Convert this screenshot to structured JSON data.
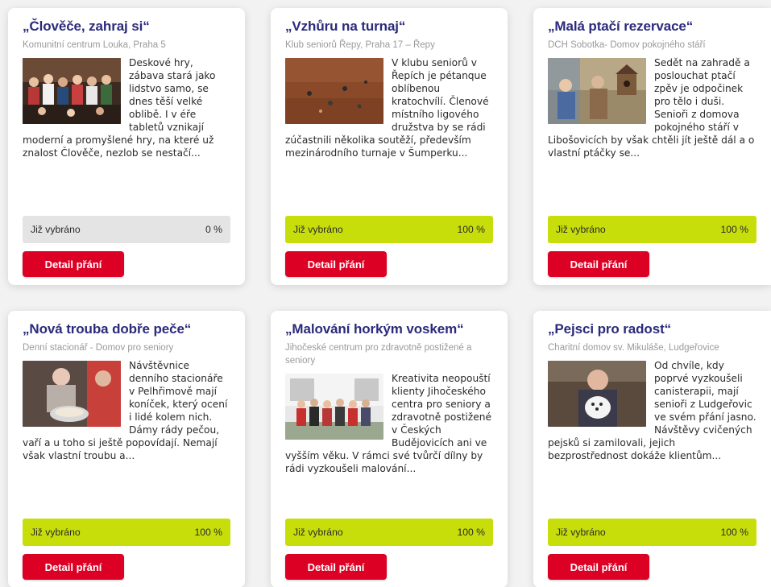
{
  "cards": [
    {
      "title": "„Člověče, zahraj si“",
      "organization": "Komunitní centrum Louka, Praha 5",
      "description": "Deskové hry, zábava stará jako lidstvo samo, se dnes těší velké oblibě. I v éře tabletů vznikají moderní a promyšlené hry, na které už znalost Člověče, nezlob se nestačí...",
      "image_icon": "group-photo",
      "progress_label": "Již vybráno",
      "progress_value": "0 %",
      "progress_fraction": 0,
      "button_label": "Detail přání"
    },
    {
      "title": "„Vzhůru na turnaj“",
      "organization": "Klub seniorů Řepy, Praha 17 – Řepy",
      "description": "V klubu seniorů v Řepích je pétanque oblíbenou kratochvílí. Členové místního ligového družstva by se rádi zúčastnili několika soutěží, především mezinárodního turnaje v Šumperku...",
      "image_icon": "petanque-photo",
      "progress_label": "Již vybráno",
      "progress_value": "100 %",
      "progress_fraction": 1,
      "button_label": "Detail přání"
    },
    {
      "title": "„Malá ptačí rezervace“",
      "organization": "DCH Sobotka- Domov pokojného stáří",
      "description": "Sedět na zahradě a poslouchat ptačí zpěv je odpočinek pro tělo i duši. Senioři z domova pokojného stáří v Libošovicích by však chtěli jít ještě dál a o vlastní ptáčky se...",
      "image_icon": "birdhouse-photo",
      "progress_label": "Již vybráno",
      "progress_value": "100 %",
      "progress_fraction": 1,
      "button_label": "Detail přání"
    },
    {
      "title": "„Nová trouba dobře peče“",
      "organization": "Denní stacionář - Domov pro seniory",
      "description": "Návštěvnice denního stacionáře v Pelhřimově mají koníček, který ocení i lidé kolem nich. Dámy rády pečou, vaří a u toho si ještě popovídají. Nemají však vlastní troubu a...",
      "image_icon": "baking-photo",
      "progress_label": "Již vybráno",
      "progress_value": "100 %",
      "progress_fraction": 1,
      "button_label": "Detail přání"
    },
    {
      "title": "„Malování horkým voskem“",
      "organization": "Jihočeské centrum pro zdravotně postižené a seniory",
      "description": "Kreativita neopouští klienty Jihočeského centra pro seniory a zdravotně postižené v Českých Budějovicích ani ve vyšším věku. V rámci své tvůrčí dílny by rádi vyzkoušeli malování...",
      "image_icon": "group-outdoor-photo",
      "progress_label": "Již vybráno",
      "progress_value": "100 %",
      "progress_fraction": 1,
      "button_label": "Detail přání"
    },
    {
      "title": "„Pejsci pro radost“",
      "organization": "Charitní domov sv. Mikuláše, Ludgeřovice",
      "description": "Od chvíle, kdy poprvé vyzkoušeli canisterapii, mají senioři z Ludgeřovic ve svém přání jasno. Návštěvy cvičených pejsků si zamilovali, jejich bezprostřednost dokáže klientům...",
      "image_icon": "dog-photo",
      "progress_label": "Již vybráno",
      "progress_value": "100 %",
      "progress_fraction": 1,
      "button_label": "Detail přání"
    }
  ],
  "colors": {
    "title": "#2b2a7c",
    "progress_fill": "#c8de0a",
    "progress_track": "#e4e4e4",
    "button": "#dc0024"
  }
}
